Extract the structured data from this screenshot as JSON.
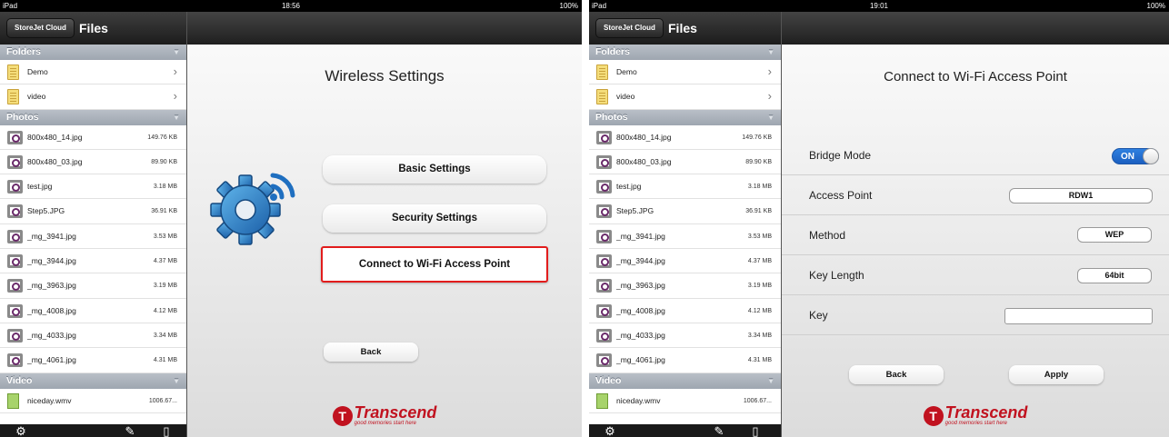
{
  "left": {
    "status": {
      "carrier": "iPad",
      "time": "18:56",
      "battery": "100%"
    },
    "sidebar": {
      "nav_button": "StoreJet Cloud",
      "title": "Files",
      "sections": {
        "folders": "Folders",
        "photos": "Photos",
        "video": "Video"
      },
      "folders": [
        {
          "name": "Demo"
        },
        {
          "name": "video"
        }
      ],
      "photos": [
        {
          "name": "800x480_14.jpg",
          "size": "149.76 KB"
        },
        {
          "name": "800x480_03.jpg",
          "size": "89.90 KB"
        },
        {
          "name": "test.jpg",
          "size": "3.18 MB"
        },
        {
          "name": "Step5.JPG",
          "size": "36.91 KB"
        },
        {
          "name": "_mg_3941.jpg",
          "size": "3.53 MB"
        },
        {
          "name": "_mg_3944.jpg",
          "size": "4.37 MB"
        },
        {
          "name": "_mg_3963.jpg",
          "size": "3.19 MB"
        },
        {
          "name": "_mg_4008.jpg",
          "size": "4.12 MB"
        },
        {
          "name": "_mg_4033.jpg",
          "size": "3.34 MB"
        },
        {
          "name": "_mg_4061.jpg",
          "size": "4.31 MB"
        }
      ],
      "videos": [
        {
          "name": "niceday.wmv",
          "size": "1006.67..."
        }
      ]
    },
    "content": {
      "title": "Wireless Settings",
      "buttons": {
        "basic": "Basic Settings",
        "security": "Security Settings",
        "connect": "Connect to Wi-Fi Access Point",
        "back": "Back"
      },
      "logo": {
        "brand": "Transcend",
        "tagline": "good memories start here"
      }
    }
  },
  "right": {
    "status": {
      "carrier": "iPad",
      "time": "19:01",
      "battery": "100%"
    },
    "sidebar": {
      "nav_button": "StoreJet Cloud",
      "title": "Files",
      "sections": {
        "folders": "Folders",
        "photos": "Photos",
        "video": "Video"
      },
      "folders": [
        {
          "name": "Demo"
        },
        {
          "name": "video"
        }
      ],
      "photos": [
        {
          "name": "800x480_14.jpg",
          "size": "149.76 KB"
        },
        {
          "name": "800x480_03.jpg",
          "size": "89.90 KB"
        },
        {
          "name": "test.jpg",
          "size": "3.18 MB"
        },
        {
          "name": "Step5.JPG",
          "size": "36.91 KB"
        },
        {
          "name": "_mg_3941.jpg",
          "size": "3.53 MB"
        },
        {
          "name": "_mg_3944.jpg",
          "size": "4.37 MB"
        },
        {
          "name": "_mg_3963.jpg",
          "size": "3.19 MB"
        },
        {
          "name": "_mg_4008.jpg",
          "size": "4.12 MB"
        },
        {
          "name": "_mg_4033.jpg",
          "size": "3.34 MB"
        },
        {
          "name": "_mg_4061.jpg",
          "size": "4.31 MB"
        }
      ],
      "videos": [
        {
          "name": "niceday.wmv",
          "size": "1006.67..."
        }
      ]
    },
    "content": {
      "title": "Connect to Wi-Fi Access Point",
      "fields": {
        "bridge_mode": {
          "label": "Bridge Mode",
          "value": "ON"
        },
        "access_point": {
          "label": "Access Point",
          "value": "RDW1"
        },
        "method": {
          "label": "Method",
          "value": "WEP"
        },
        "key_length": {
          "label": "Key Length",
          "value": "64bit"
        },
        "key": {
          "label": "Key",
          "value": ""
        }
      },
      "buttons": {
        "back": "Back",
        "apply": "Apply"
      },
      "logo": {
        "brand": "Transcend",
        "tagline": "good memories start here"
      }
    }
  },
  "icons": {
    "settings": "gear-icon",
    "edit": "edit-icon",
    "device": "device-icon",
    "chevron": "chevron-right-icon",
    "wireless_settings": "wireless-gear-icon"
  },
  "colors": {
    "highlight": "#e21c1c",
    "toggle_on": "#2f80e0",
    "brand": "#c1121f"
  }
}
